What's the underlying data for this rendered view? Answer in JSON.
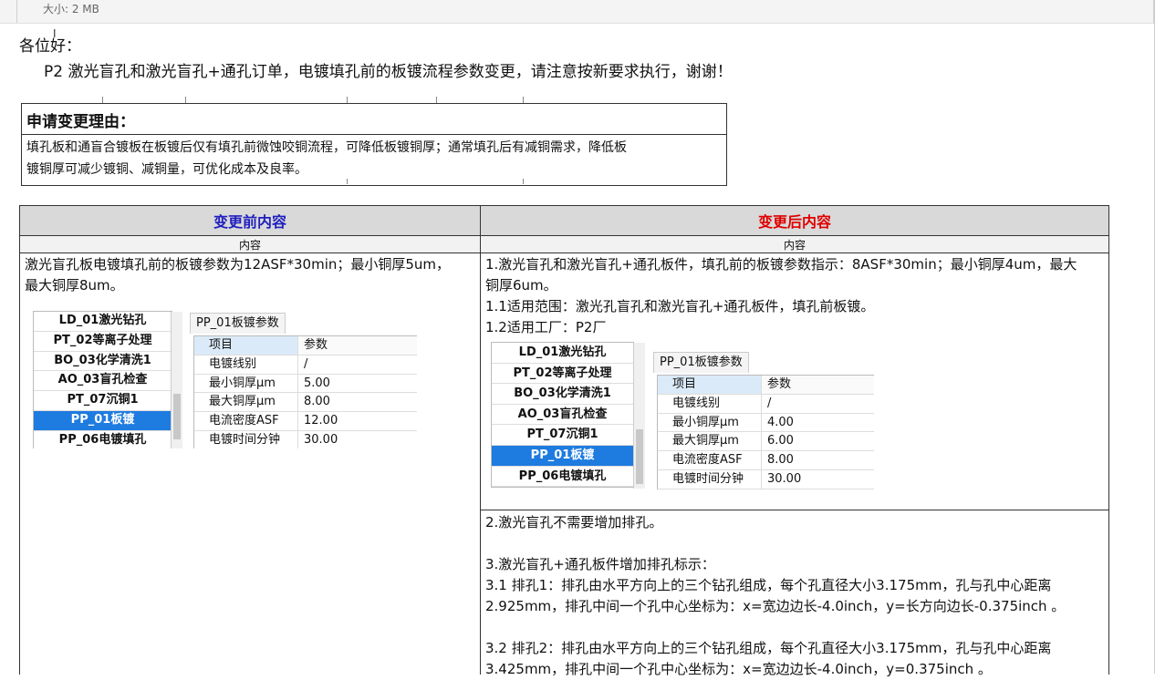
{
  "header": {
    "file_size": "大小: 2 MB"
  },
  "email": {
    "greeting": "各位好：",
    "lead": "P2 激光盲孔和激光盲孔+通孔订单，电镀填孔前的板镀流程参数变更，请注意按新要求执行，谢谢！"
  },
  "reason": {
    "title": "申请变更理由：",
    "line1": "填孔板和通盲合镀板在板镀后仅有填孔前微蚀咬铜流程，可降低板镀铜厚；通常填孔后有减铜需求，降低板",
    "line2": "镀铜厚可减少镀铜、减铜量，可优化成本及良率。"
  },
  "table": {
    "before_header": "变更前内容",
    "after_header": "变更后内容",
    "sub_label": "内容",
    "before": {
      "line1": "激光盲孔板电镀填孔前的板镀参数为12ASF*30min；最小铜厚5um，",
      "line2": "最大铜厚8um。"
    },
    "after": {
      "line1": "1.激光盲孔和激光盲孔+通孔板件，填孔前的板镀参数指示：8ASF*30min；最小铜厚4um，最大",
      "line2": "铜厚6um。",
      "line3": "1.1适用范围：激光孔盲孔和激光盲孔+通孔板件，填孔前板镀。",
      "line4": "1.2适用工厂：P2厂",
      "line5": "2.激光盲孔不需要增加排孔。",
      "line6": "3.激光盲孔+通孔板件增加排孔标示：",
      "line7": "3.1 排孔1：排孔由水平方向上的三个钻孔组成，每个孔直径大小3.175mm，孔与孔中心距离",
      "line8": "2.925mm，排孔中间一个孔中心坐标为：x=宽边边长-4.0inch，y=长方向边长-0.375inch 。",
      "line9": "3.2 排孔2：排孔由水平方向上的三个钻孔组成，每个孔直径大小3.175mm，孔与孔中心距离",
      "line10": "3.425mm，排孔中间一个孔中心坐标为：x=宽边边长-4.0inch，y=0.375inch 。"
    }
  },
  "screenshot_before": {
    "process_list": [
      "LD_01激光钻孔",
      "PT_02等离子处理",
      "BO_03化学清洗1",
      "AO_03盲孔检查",
      "PT_07沉铜1",
      "PP_01板镀",
      "PP_06电镀填孔"
    ],
    "tab": "PP_01板镀参数",
    "grid_header": [
      "项目",
      "参数"
    ],
    "rows": [
      [
        "电镀线别",
        "/"
      ],
      [
        "最小铜厚μm",
        "5.00"
      ],
      [
        "最大铜厚μm",
        "8.00"
      ],
      [
        "电流密度ASF",
        "12.00"
      ],
      [
        "电镀时间分钟",
        "30.00"
      ]
    ]
  },
  "screenshot_after": {
    "process_list": [
      "LD_01激光钻孔",
      "PT_02等离子处理",
      "BO_03化学清洗1",
      "AO_03盲孔检查",
      "PT_07沉铜1",
      "PP_01板镀",
      "PP_06电镀填孔"
    ],
    "tab": "PP_01板镀参数",
    "grid_header": [
      "项目",
      "参数"
    ],
    "rows": [
      [
        "电镀线别",
        "/"
      ],
      [
        "最小铜厚μm",
        "4.00"
      ],
      [
        "最大铜厚μm",
        "6.00"
      ],
      [
        "电流密度ASF",
        "8.00"
      ],
      [
        "电镀时间分钟",
        "30.00"
      ]
    ]
  }
}
